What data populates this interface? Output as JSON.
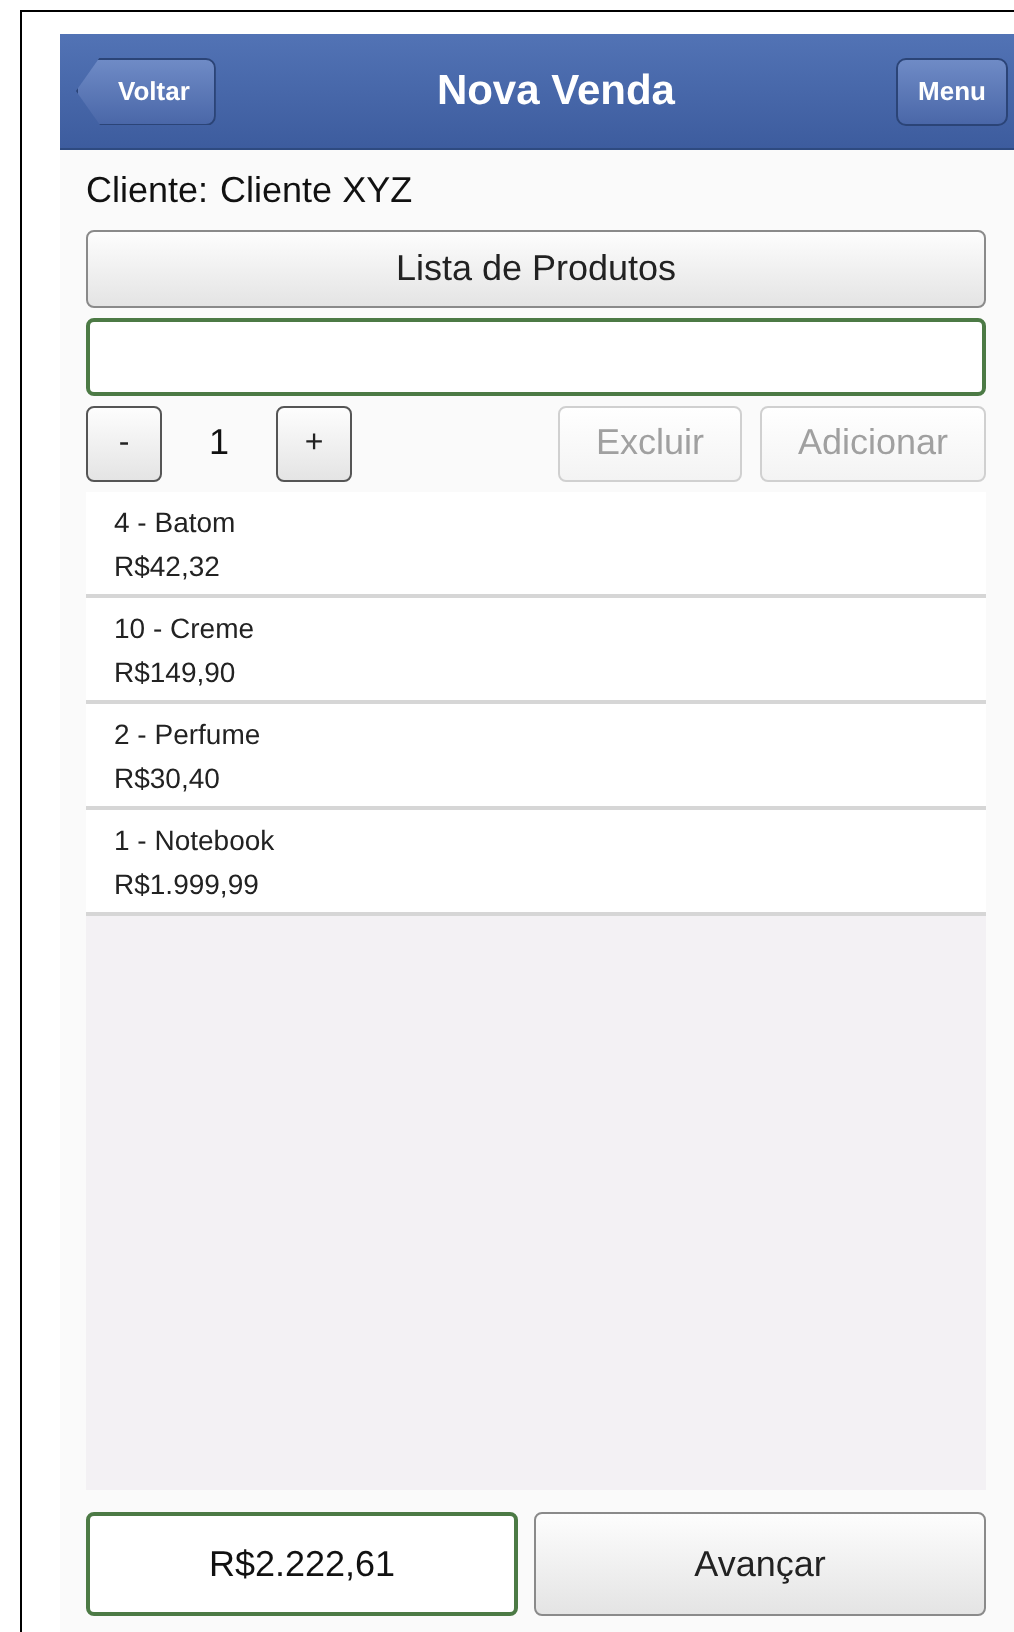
{
  "header": {
    "back_button": "Voltar",
    "title": "Nova Venda",
    "menu_button": "Menu"
  },
  "client": {
    "label": "Cliente:",
    "value": "Cliente XYZ"
  },
  "product_list_button": "Lista de Produtos",
  "quantity": {
    "minus": "-",
    "value": "1",
    "plus": "+"
  },
  "actions": [
    {
      "label": "Excluir",
      "disabled": true
    },
    {
      "label": "Adicionar",
      "disabled": true
    }
  ],
  "items": [
    {
      "name": "4 - Batom",
      "price": "R$42,32"
    },
    {
      "name": "10 - Creme",
      "price": "R$149,90"
    },
    {
      "name": "2 - Perfume",
      "price": "R$30,40"
    },
    {
      "name": "1 - Notebook",
      "price": "R$1.999,99"
    }
  ],
  "total": "R$2.222,61",
  "next_button": "Avançar"
}
